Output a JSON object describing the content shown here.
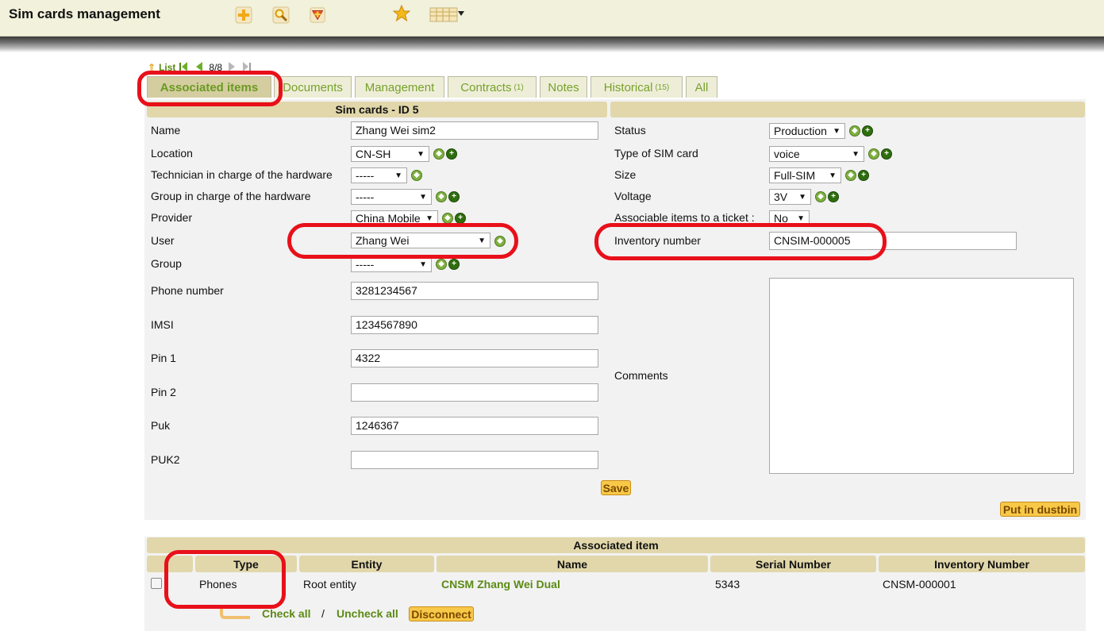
{
  "app_title": "Sim cards management",
  "toolbar": {
    "icons": [
      "add-icon",
      "search-icon",
      "template-icon",
      "star-icon",
      "columns-icon"
    ]
  },
  "nav": {
    "list_label": "List",
    "position": "8/8"
  },
  "tabs": [
    {
      "label": "Associated items",
      "count": ""
    },
    {
      "label": "Documents",
      "count": ""
    },
    {
      "label": "Management",
      "count": ""
    },
    {
      "label": "Contracts",
      "count": "(1)"
    },
    {
      "label": "Notes",
      "count": ""
    },
    {
      "label": "Historical",
      "count": "(15)"
    },
    {
      "label": "All",
      "count": ""
    }
  ],
  "form": {
    "title": "Sim cards - ID 5",
    "left": {
      "name": {
        "label": "Name",
        "value": "Zhang Wei sim2"
      },
      "location": {
        "label": "Location",
        "value": "CN-SH"
      },
      "technician": {
        "label": "Technician in charge of the hardware",
        "value": "-----"
      },
      "group_hw": {
        "label": "Group in charge of the hardware",
        "value": "-----"
      },
      "provider": {
        "label": "Provider",
        "value": "China Mobile"
      },
      "user": {
        "label": "User",
        "value": "Zhang Wei"
      },
      "group": {
        "label": "Group",
        "value": "-----"
      },
      "phone": {
        "label": "Phone number",
        "value": "3281234567"
      },
      "imsi": {
        "label": "IMSI",
        "value": "1234567890"
      },
      "pin1": {
        "label": "Pin 1",
        "value": "4322"
      },
      "pin2": {
        "label": "Pin 2",
        "value": ""
      },
      "puk": {
        "label": "Puk",
        "value": "1246367"
      },
      "puk2": {
        "label": "PUK2",
        "value": ""
      }
    },
    "right": {
      "status": {
        "label": "Status",
        "value": "Production"
      },
      "sim_type": {
        "label": "Type of SIM card",
        "value": "voice"
      },
      "size": {
        "label": "Size",
        "value": "Full-SIM"
      },
      "voltage": {
        "label": "Voltage",
        "value": "3V"
      },
      "associable": {
        "label": "Associable items to a ticket :",
        "value": "No"
      },
      "inventory": {
        "label": "Inventory number",
        "value": "CNSIM-000005"
      },
      "comments": {
        "label": "Comments",
        "value": ""
      }
    },
    "save_label": "Save",
    "dustbin_label": "Put in dustbin"
  },
  "associated": {
    "title": "Associated item",
    "columns": [
      "Type",
      "Entity",
      "Name",
      "Serial Number",
      "Inventory Number"
    ],
    "rows": [
      {
        "type": "Phones",
        "entity": "Root entity",
        "name": "CNSM Zhang Wei Dual",
        "serial": "5343",
        "inventory": "CNSM-000001"
      }
    ],
    "check_all": "Check all",
    "separator": "/",
    "uncheck_all": "Uncheck all",
    "disconnect": "Disconnect"
  },
  "colors": {
    "header_bg": "#f1f1dc",
    "band_bg": "#e1d7aa",
    "panel_bg": "#f2f2f2",
    "link_green": "#5c8a15",
    "button_orange": "#f8c848",
    "annotation_red": "#e8101a"
  }
}
